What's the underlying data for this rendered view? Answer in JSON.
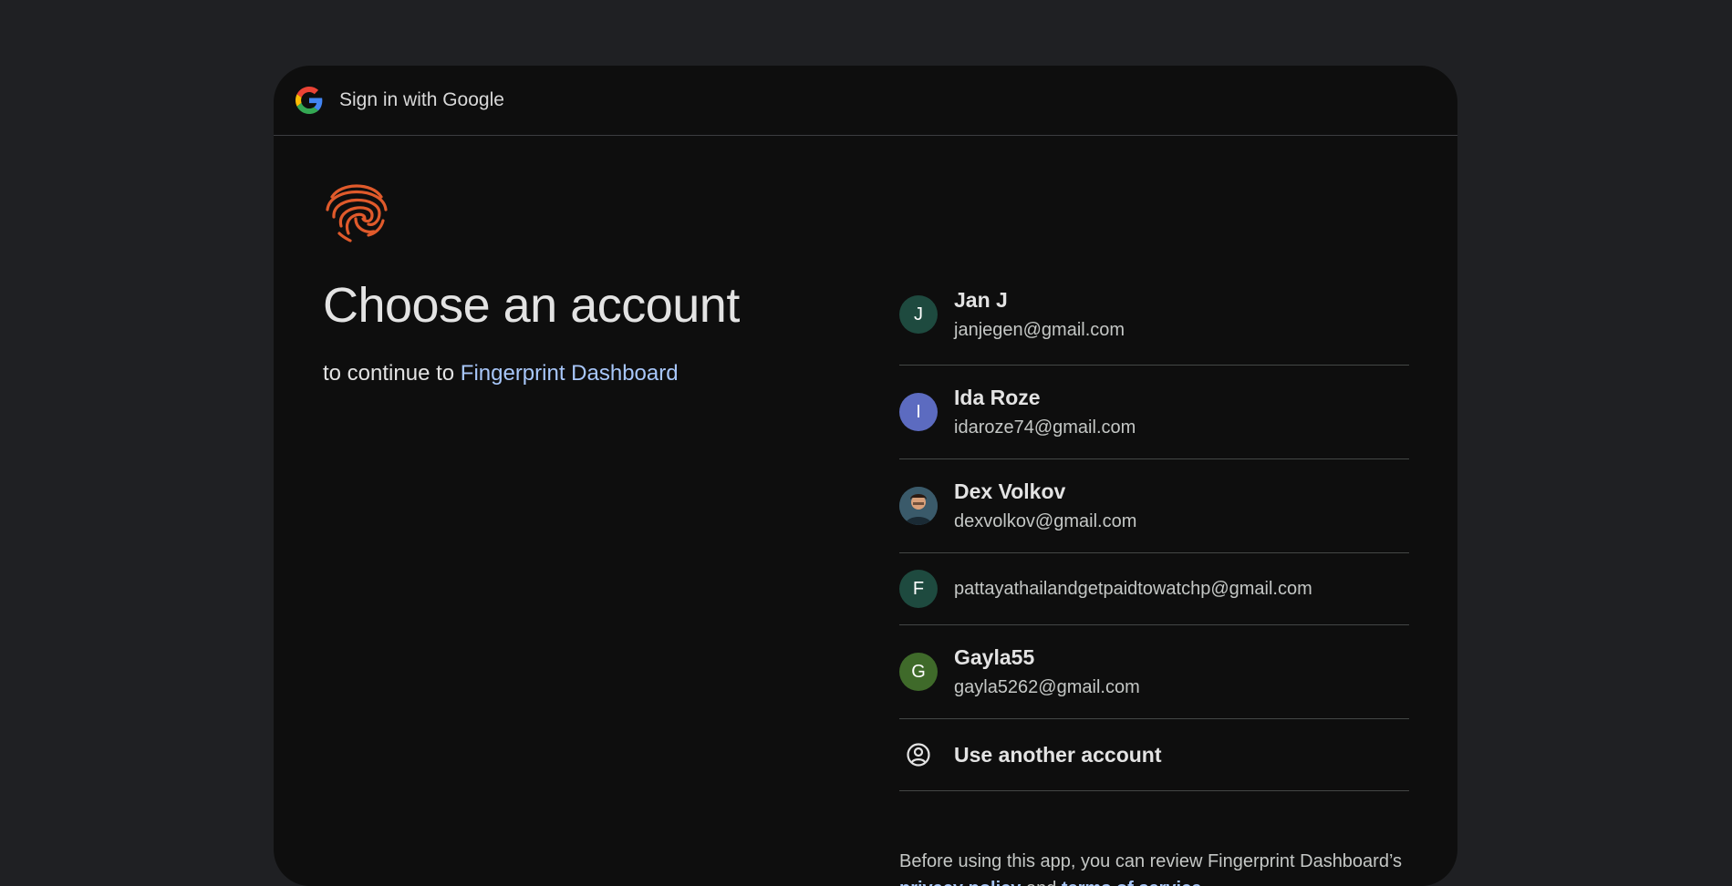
{
  "header": {
    "title": "Sign in with Google"
  },
  "main": {
    "title": "Choose an account",
    "subtitle_prefix": "to continue to",
    "app_name": "Fingerprint Dashboard"
  },
  "accounts": [
    {
      "initial": "J",
      "name": "Jan J",
      "email": "janjegen@gmail.com",
      "avatar_color": "#1e4a3f"
    },
    {
      "initial": "I",
      "name": "Ida Roze",
      "email": "idaroze74@gmail.com",
      "avatar_color": "#5c6bc0"
    },
    {
      "initial": "",
      "name": "Dex Volkov",
      "email": "dexvolkov@gmail.com",
      "avatar_color": "#3a5a6a"
    },
    {
      "initial": "F",
      "name": "",
      "email": "pattayathailandgetpaidtowatchp@gmail.com",
      "avatar_color": "#1e4a3f"
    },
    {
      "initial": "G",
      "name": "Gayla55",
      "email": "gayla5262@gmail.com",
      "avatar_color": "#3f6a2a"
    }
  ],
  "use_another": {
    "label": "Use another account",
    "icon": "account-circle-icon"
  },
  "footer": {
    "text_before": "Before using this app, you can review Fingerprint Dashboard’s",
    "privacy_label": "privacy policy",
    "and": "and",
    "terms_label": "terms of service",
    "period": "."
  },
  "colors": {
    "background": "#1f2023",
    "card": "#0e0e0e",
    "link": "#a8c7fa",
    "brand": "#e05a2b"
  }
}
